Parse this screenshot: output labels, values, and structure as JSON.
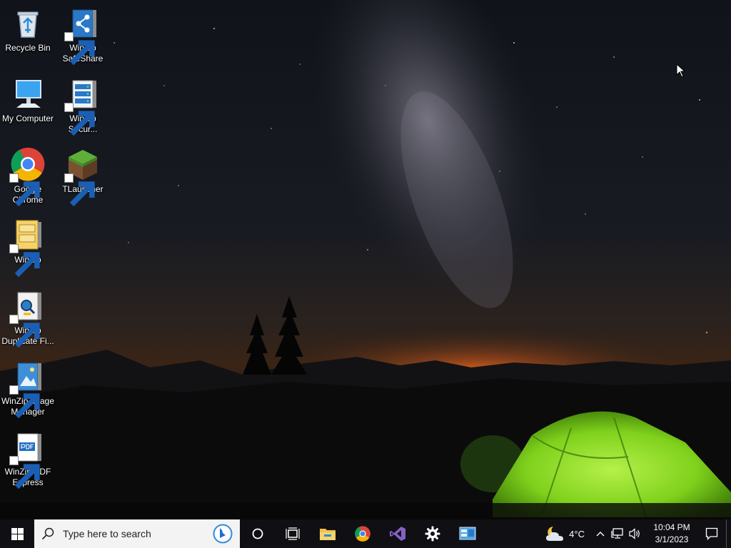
{
  "desktop": {
    "icons": [
      {
        "label": "Recycle Bin",
        "icon": "recycle-bin-icon"
      },
      {
        "label": "WinZip SafeShare",
        "icon": "winzip-safeshare-icon"
      },
      {
        "label": "My Computer",
        "icon": "my-computer-icon"
      },
      {
        "label": "WinZip Secur...",
        "icon": "winzip-secure-backup-icon"
      },
      {
        "label": "Google Chrome",
        "icon": "google-chrome-icon"
      },
      {
        "label": "TLauncher",
        "icon": "tlauncher-icon"
      },
      {
        "label": "WinZip",
        "icon": "winzip-icon"
      },
      {
        "label": "WinZip Duplicate Fi...",
        "icon": "winzip-duplicate-finder-icon"
      },
      {
        "label": "WinZip Image Manager",
        "icon": "winzip-image-manager-icon"
      },
      {
        "label": "WinZip PDF Express",
        "icon": "winzip-pdf-express-icon"
      }
    ]
  },
  "taskbar": {
    "search_placeholder": "Type here to search",
    "pinned": [
      "cortana-icon",
      "task-view-icon",
      "file-explorer-icon",
      "chrome-icon",
      "visual-studio-icon",
      "settings-icon",
      "control-panel-icon"
    ],
    "weather": {
      "temp": "4°C",
      "icon": "partly-cloudy-night-icon"
    },
    "clock": {
      "time": "10:04 PM",
      "date": "3/1/2023"
    }
  },
  "colors": {
    "taskbar_bg": "#101014",
    "search_bg": "#f3f3f3",
    "tent_green": "#7fd11c",
    "horizon_orange": "#e0621a"
  }
}
